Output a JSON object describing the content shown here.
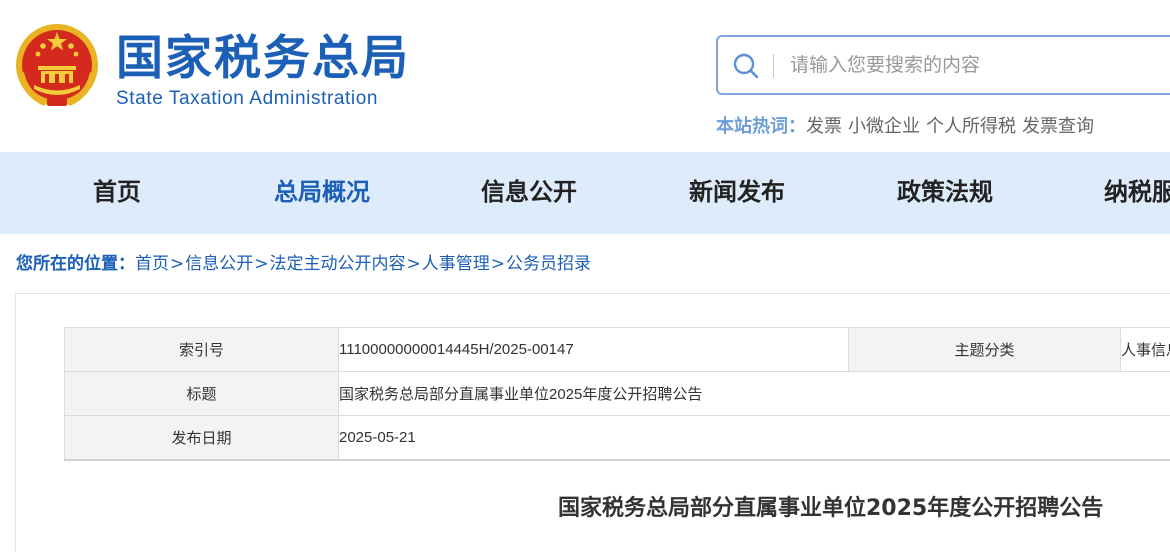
{
  "header": {
    "site_name_cn": "国家税务总局",
    "site_name_en": "State Taxation Administration",
    "emblem_icon": "national-emblem-icon"
  },
  "search": {
    "placeholder": "请输入您要搜索的内容",
    "icon": "search-icon"
  },
  "hotwords": {
    "label": "本站热词：",
    "items": [
      "发票",
      "小微企业",
      "个人所得税",
      "发票查询"
    ]
  },
  "nav": {
    "items": [
      {
        "label": "首页",
        "active": false
      },
      {
        "label": "总局概况",
        "active": true
      },
      {
        "label": "信息公开",
        "active": false
      },
      {
        "label": "新闻发布",
        "active": false
      },
      {
        "label": "政策法规",
        "active": false
      },
      {
        "label": "纳税服务",
        "active": false
      }
    ]
  },
  "breadcrumb": {
    "label": "您所在的位置：",
    "items": [
      "首页",
      "信息公开",
      "法定主动公开内容",
      "人事管理",
      "公务员招录"
    ],
    "separator": ">"
  },
  "meta": {
    "index_label": "索引号",
    "index_value": "11100000000014445H/2025-00147",
    "topic_label": "主题分类",
    "topic_value": "人事信息",
    "title_label": "标题",
    "title_value": "国家税务总局部分直属事业单位2025年度公开招聘公告",
    "date_label": "发布日期",
    "date_value": "2025-05-21"
  },
  "article": {
    "title": "国家税务总局部分直属事业单位2025年度公开招聘公告"
  },
  "colors": {
    "brand_blue": "#1c5fb7",
    "nav_bg": "#ddebfb",
    "hotword_label": "#6e9ed8"
  }
}
